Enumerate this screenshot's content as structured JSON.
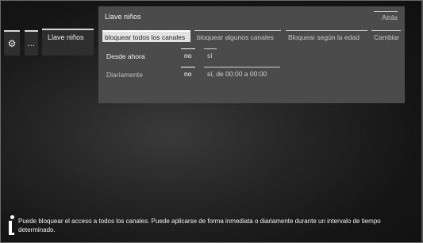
{
  "nav": {
    "settings_icon": "gear-icon",
    "more_label": "...",
    "breadcrumb_label": "Llave niños"
  },
  "panel": {
    "title": "Llave niños",
    "back_label": "Atrás",
    "tabs": [
      {
        "label": "bloquear todos los canales",
        "active": true
      },
      {
        "label": "bloquear algunos canales",
        "active": false
      },
      {
        "label": "Bloquear según la edad",
        "active": false
      },
      {
        "label": "Cambiar",
        "active": false
      }
    ],
    "rows": [
      {
        "label": "Desde ahora",
        "options": [
          {
            "label": "no",
            "selected": true
          },
          {
            "label": "sí",
            "selected": false
          }
        ]
      },
      {
        "label": "Diariamente",
        "options": [
          {
            "label": "no",
            "selected": true
          },
          {
            "label": "sí, de 00:00 a 00:00",
            "selected": false
          }
        ]
      }
    ]
  },
  "info": {
    "icon": "info-icon",
    "text": "Puede bloquear el acceso a todos los canales. Puede aplicarse de forma inmediata o diariamente durante un intervalo de tiempo determinado."
  }
}
